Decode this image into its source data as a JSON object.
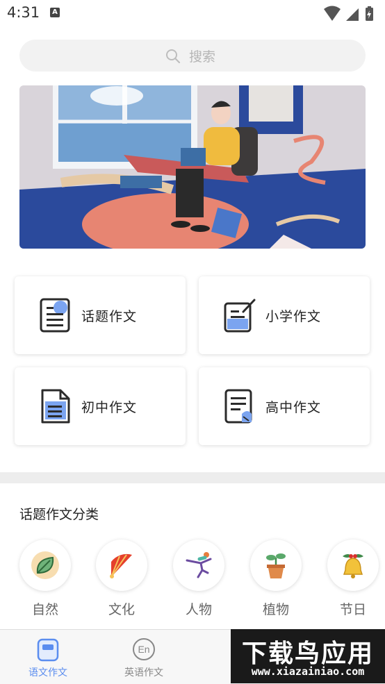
{
  "status_bar": {
    "time": "4:31",
    "notification_letter": "A"
  },
  "search": {
    "placeholder": "搜索"
  },
  "cards": [
    {
      "label": "话题作文",
      "icon": "topic-doc-icon"
    },
    {
      "label": "小学作文",
      "icon": "edit-doc-icon"
    },
    {
      "label": "初中作文",
      "icon": "file-doc-icon"
    },
    {
      "label": "高中作文",
      "icon": "note-doc-icon"
    }
  ],
  "section": {
    "title": "话题作文分类"
  },
  "categories": [
    {
      "label": "自然",
      "icon": "leaf-icon"
    },
    {
      "label": "文化",
      "icon": "fan-icon"
    },
    {
      "label": "人物",
      "icon": "skater-icon"
    },
    {
      "label": "植物",
      "icon": "potted-plant-icon"
    },
    {
      "label": "节日",
      "icon": "bell-icon"
    }
  ],
  "tabs": [
    {
      "label": "语文作文",
      "active": true
    },
    {
      "label": "英语作文",
      "active": false
    }
  ],
  "watermark": {
    "title": "下载鸟应用",
    "url": "www.xiazainiao.com"
  },
  "colors": {
    "accent": "#5b8def",
    "inactive": "#888888"
  }
}
